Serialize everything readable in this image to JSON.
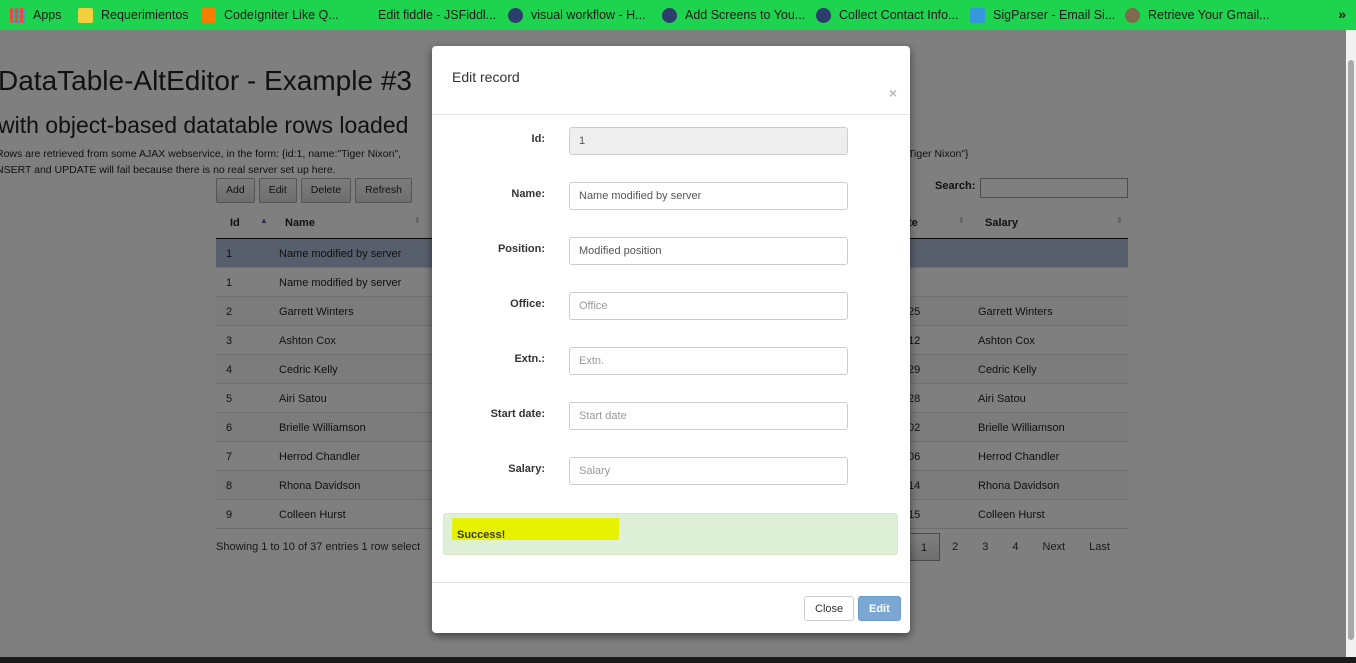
{
  "bookmarks": [
    {
      "label": "Apps",
      "icon": "apps-grid-icon",
      "color": "#e74c3c"
    },
    {
      "label": "Requerimientos",
      "icon": "folder-icon",
      "color": "#f4d03f"
    },
    {
      "label": "CodeIgniter Like Q...",
      "icon": "blogger-icon",
      "color": "#f57d00"
    },
    {
      "label": "Edit fiddle - JSFiddl...",
      "icon": "fiddle-icon",
      "color": "#1ed44f"
    },
    {
      "label": "visual workflow - H...",
      "icon": "cloud-icon",
      "color": "#2c3e6b"
    },
    {
      "label": "Add Screens to You...",
      "icon": "mountain-icon",
      "color": "#2c3e6b"
    },
    {
      "label": "Collect Contact Info...",
      "icon": "mountain-icon",
      "color": "#2c3e6b"
    },
    {
      "label": "SigParser - Email Si...",
      "icon": "sigparser-icon",
      "color": "#3498db"
    },
    {
      "label": "Retrieve Your Gmail...",
      "icon": "gear-icon",
      "color": "#7f6a4d"
    }
  ],
  "bookmarks_more": "»",
  "page": {
    "title": "DataTable-AltEditor - Example #3",
    "subtitle": "with object-based datatable rows loaded",
    "description_line1": "Rows are retrieved from some AJAX webservice, in the form: {id:1, name:\"Tiger Nixon\",",
    "description_line1_tail": "Tiger Nixon\"}",
    "description_line2": "NSERT and UPDATE will fail because there is no real server set up here.",
    "toolbar": {
      "add": "Add",
      "edit": "Edit",
      "delete": "Delete",
      "refresh": "Refresh"
    },
    "search_label": "Search:",
    "columns": {
      "id": "Id",
      "name": "Name",
      "start_date": "te",
      "salary": "Salary"
    },
    "rows": [
      {
        "id": "1",
        "name": "Name modified by server",
        "start": "",
        "salary": "",
        "selected": true
      },
      {
        "id": "1",
        "name": "Name modified by server",
        "start": "",
        "salary": ""
      },
      {
        "id": "2",
        "name": "Garrett Winters",
        "start": "25",
        "salary": "Garrett Winters"
      },
      {
        "id": "3",
        "name": "Ashton Cox",
        "start": "12",
        "salary": "Ashton Cox"
      },
      {
        "id": "4",
        "name": "Cedric Kelly",
        "start": "29",
        "salary": "Cedric Kelly"
      },
      {
        "id": "5",
        "name": "Airi Satou",
        "start": "28",
        "salary": "Airi Satou"
      },
      {
        "id": "6",
        "name": "Brielle Williamson",
        "start": "02",
        "salary": "Brielle Williamson"
      },
      {
        "id": "7",
        "name": "Herrod Chandler",
        "start": "06",
        "salary": "Herrod Chandler"
      },
      {
        "id": "8",
        "name": "Rhona Davidson",
        "start": "14",
        "salary": "Rhona Davidson"
      },
      {
        "id": "9",
        "name": "Colleen Hurst",
        "start": "15",
        "salary": "Colleen Hurst"
      }
    ],
    "info": "Showing 1 to 10 of 37 entries     1 row select",
    "pager": [
      "1",
      "2",
      "3",
      "4",
      "Next",
      "Last"
    ]
  },
  "modal": {
    "title": "Edit record",
    "close_symbol": "×",
    "fields": [
      {
        "label": "Id:",
        "value": "1",
        "placeholder": "",
        "readonly": true
      },
      {
        "label": "Name:",
        "value": "Name modified by server",
        "placeholder": ""
      },
      {
        "label": "Position:",
        "value": "Modified position",
        "placeholder": ""
      },
      {
        "label": "Office:",
        "value": "",
        "placeholder": "Office"
      },
      {
        "label": "Extn.:",
        "value": "",
        "placeholder": "Extn."
      },
      {
        "label": "Start date:",
        "value": "",
        "placeholder": "Start date"
      },
      {
        "label": "Salary:",
        "value": "",
        "placeholder": "Salary"
      }
    ],
    "alert": "Success!",
    "close_button": "Close",
    "edit_button": "Edit"
  },
  "colors": {
    "bookmark_bar": "#1ed44f",
    "selected_row": "#b0bed9",
    "alert_bg": "#dff0d8",
    "highlighter": "#e6f200",
    "primary_button": "#7aa7d4"
  }
}
